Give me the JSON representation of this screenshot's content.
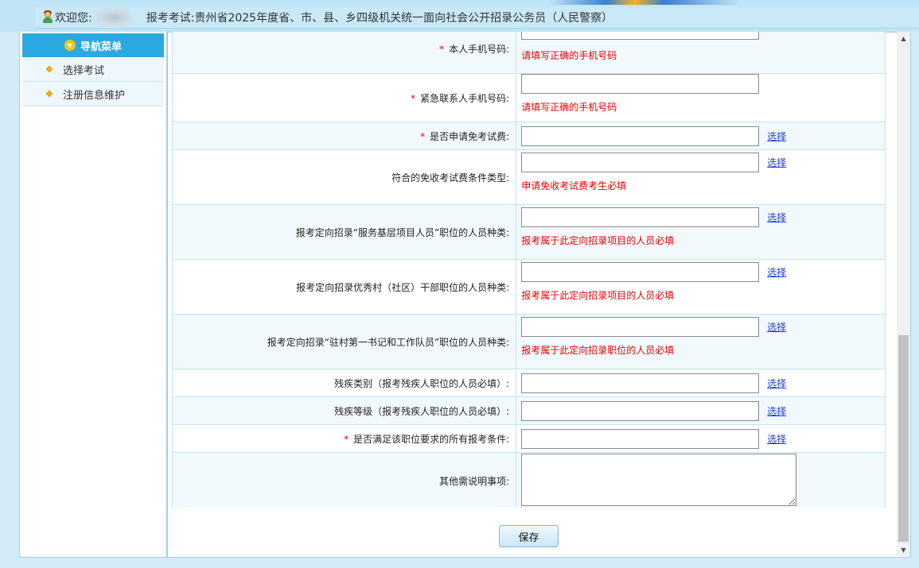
{
  "header": {
    "welcome": "欢迎您:",
    "exam_prefix": "报考考试:",
    "exam_name": "贵州省2025年度省、市、县、乡四级机关统一面向社会公开招录公务员（人民警察）"
  },
  "sidebar": {
    "title": "导航菜单",
    "items": [
      {
        "label": "选择考试"
      },
      {
        "label": "注册信息维护"
      }
    ]
  },
  "form": {
    "select_label": "选择",
    "required_mark": "*",
    "rows": [
      {
        "label": "本人手机号码:",
        "hint": "请填写正确的手机号码"
      },
      {
        "label": "紧急联系人手机号码:",
        "hint": "请填写正确的手机号码"
      },
      {
        "label": "是否申请免考试费:"
      },
      {
        "label": "符合的免收考试费条件类型:",
        "hint": "申请免收考试费考生必填"
      },
      {
        "label": "报考定向招录“服务基层项目人员”职位的人员种类:",
        "hint": "报考属于此定向招录项目的人员必填"
      },
      {
        "label": "报考定向招录优秀村（社区）干部职位的人员种类:",
        "hint": "报考属于此定向招录项目的人员必填"
      },
      {
        "label": "报考定向招录“驻村第一书记和工作队员”职位的人员种类:",
        "hint": "报考属于此定向招录职位的人员必填"
      },
      {
        "label": "残疾类别（报考残疾人职位的人员必填）:"
      },
      {
        "label": "残疾等级（报考残疾人职位的人员必填）:"
      },
      {
        "label": "是否满足该职位要求的所有报考条件:"
      },
      {
        "label": "其他需说明事项:"
      }
    ]
  },
  "save_label": "保存",
  "colors": {
    "accent": "#2aa9e0",
    "required": "#ee0000",
    "link": "#1a3cc7"
  }
}
